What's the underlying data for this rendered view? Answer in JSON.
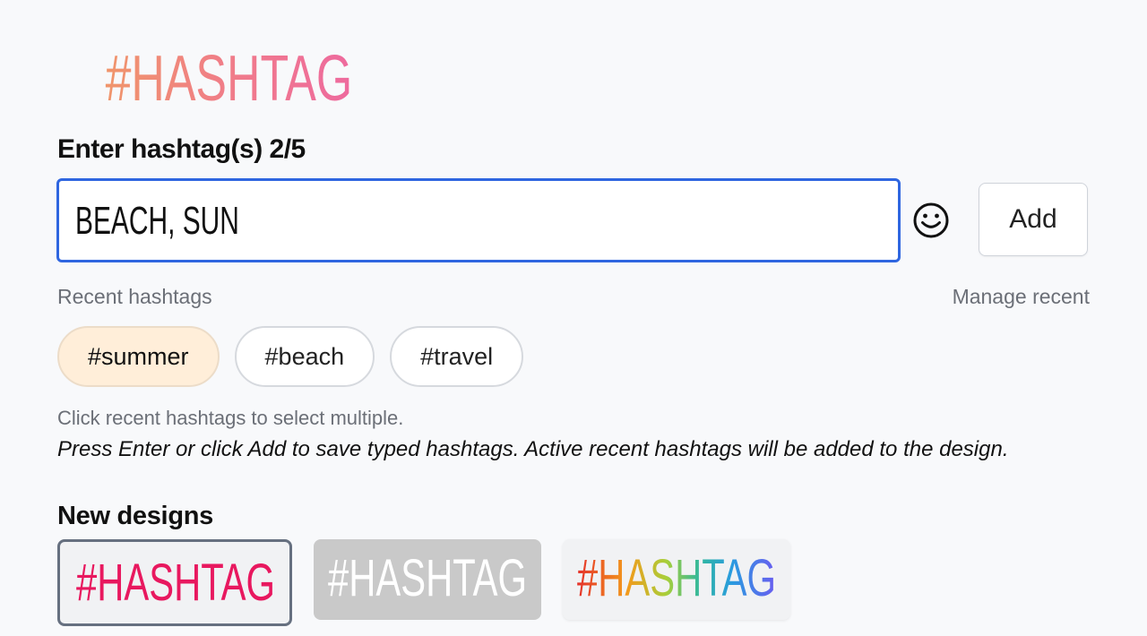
{
  "header": {
    "title": "#HASHTAG"
  },
  "form": {
    "label": "Enter hashtag(s) 2/5",
    "input_value": "BEACH, SUN",
    "add_label": "Add"
  },
  "recent": {
    "label": "Recent hashtags",
    "manage_label": "Manage recent",
    "chips": [
      {
        "label": "#summer",
        "active": true
      },
      {
        "label": "#beach",
        "active": false
      },
      {
        "label": "#travel",
        "active": false
      }
    ]
  },
  "help": {
    "line1": "Click recent hashtags to select multiple.",
    "line2": "Press Enter or click Add to save typed hashtags. Active recent hashtags will be added to the design."
  },
  "designs": {
    "label": "New designs",
    "items": [
      {
        "text": "#HASHTAG",
        "style": "magenta-outline"
      },
      {
        "text": "#HASHTAG",
        "style": "white-on-gray"
      },
      {
        "text": "#HASHTAG",
        "style": "rainbow"
      }
    ]
  },
  "colors": {
    "input_border": "#2f66e0",
    "active_chip": "#ffeed9",
    "design1_text": "#e8185f",
    "design2_bg": "#c9c9c9"
  },
  "icons": {
    "emoji_button": "smiley-face-icon"
  }
}
